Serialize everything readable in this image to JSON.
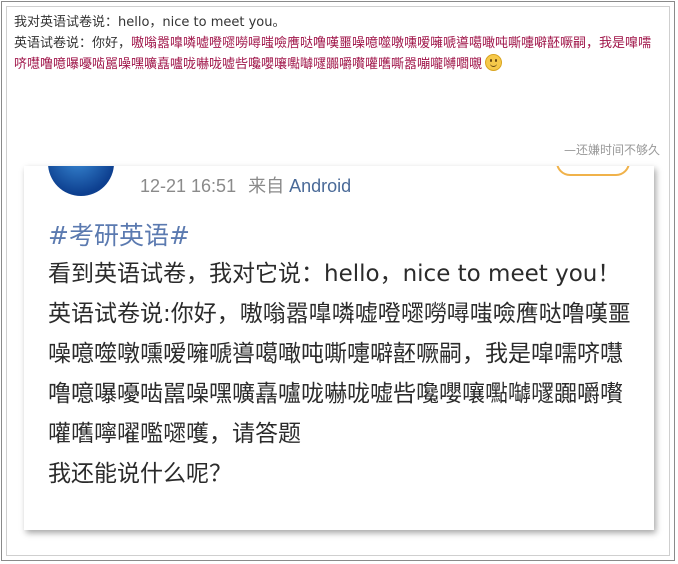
{
  "post": {
    "line1": "我对英语试卷说：hello，nice to meet you。",
    "line2_prefix": "英语试卷说：你好，",
    "line2_garbled": "嗷嗡嚣嘷噒嘘噔嚃嘮噚嗤噞噟哒噜嘆噩噪噫噬噋嚑嗳噰嗁噵噶噉吨嘶嚏噼噽噘嗣，我是噑嚅哜嚖噜噫嚗嚘啮嚚噪嘿嚝嚞嚧咙嚇咙嘘呰嚵嚶嚷嚸嚹嚺嚻嚼嚽嚾嚿嘶嚣嘣嚨嚩嚪嚫",
    "signature": "—还嫌时间不够久"
  },
  "screenshot": {
    "timestamp": "12-21 16:51",
    "from_label": "来自",
    "source": "Android",
    "hashtag": "#考研英语#",
    "lines": [
      "看到英语试卷，我对它说：hello，nice to meet you！",
      "英语试卷说:你好，嗷嗡嚣嘷噒嘘噔嚃嘮噚嗤噞噟哒噜嘆噩噪噫噬噋嚑嗳噰嗁噵噶噉吨嘶嚏噼噽噘嗣，我是噑嚅哜嚖噜噫嚗嚘啮嚚噪嘿嚝嚞嚧咙嚇咙嘘呰嚵嚶嚷嚸嚹嚺嚻嚼嚽嚾嚿嚀嚁嚂嚃嚄，请答题",
      "我还能说什么呢？"
    ]
  },
  "colors": {
    "garbled": "#a0164a",
    "source_link": "#4a6a98",
    "hashtag": "#5b7ab0"
  }
}
